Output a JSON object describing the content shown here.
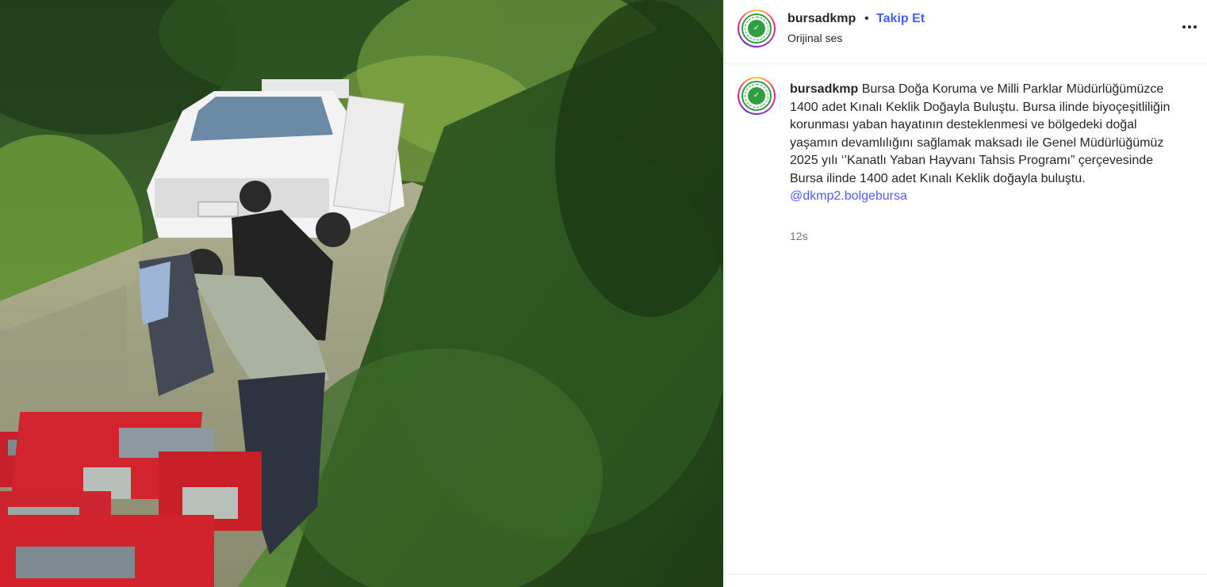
{
  "media": {
    "description_icon": "video-frame"
  },
  "post": {
    "username": "bursadkmp",
    "separator": "•",
    "follow_label": "Takip Et",
    "audio_label": "Orijinal ses",
    "more_icon": "more-horizontal-icon"
  },
  "caption": {
    "username": "bursadkmp",
    "text": "Bursa Doğa Koruma ve Milli Parklar Müdürlüğümüzce 1400 adet Kınalı Keklik Doğayla Buluştu. Bursa ilinde biyoçeşitliliğin korunması yaban hayatının desteklenmesi ve bölgedeki doğal yaşamın devamlılığını sağlamak maksadı ile Genel Müdürlüğümüz 2025 yılı ‘’Kanatlı Yaban Hayvanı Tahsis Programı” çerçevesinde Bursa ilinde 1400 adet Kınalı Keklik doğayla buluştu.",
    "mention": "@dkmp2.bolgebursa",
    "timestamp": "12s"
  },
  "colors": {
    "link": "#4a5df9",
    "text": "#262626",
    "muted": "#737373",
    "logo_green": "#2e9e3e"
  }
}
